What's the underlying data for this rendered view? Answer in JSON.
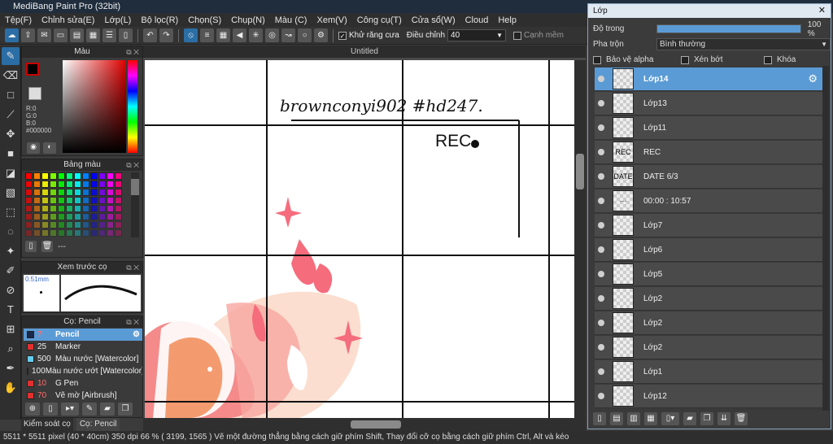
{
  "window": {
    "title": "MediBang Paint Pro (32bit)"
  },
  "menu": [
    "Tệp(F)",
    "Chỉnh sửa(E)",
    "Lớp(L)",
    "Bộ lọc(R)",
    "Chọn(S)",
    "Chụp(N)",
    "Màu (C)",
    "Xem(V)",
    "Công cụ(T)",
    "Cửa sổ(W)",
    "Cloud",
    "Help"
  ],
  "toolbar": {
    "antialias_label": "Khử răng cưa",
    "correction_label": "Điều chỉnh",
    "correction_value": "40",
    "edge_label": "Cạnh mềm"
  },
  "color_panel": {
    "title": "Màu",
    "r": "R:0",
    "g": "G:0",
    "b": "B:0",
    "hex": "#000000",
    "fg": "#000000",
    "bg": "#ffffff"
  },
  "palette": {
    "title": "Bảng màu",
    "footer": "---"
  },
  "preview": {
    "title": "Xem trước cọ",
    "size": "0.51mm"
  },
  "brush_panel": {
    "title": "Cọ: Pencil",
    "items": [
      {
        "size": "7",
        "name": "Pencil",
        "color": "#1a2a4a",
        "selected": true
      },
      {
        "size": "25",
        "name": "Marker",
        "color": "#e03030"
      },
      {
        "size": "500",
        "name": "Màu nước [Watercolor]",
        "color": "#66ccee"
      },
      {
        "size": "100",
        "name": "Màu nước ướt [Watercolor]",
        "color": "#66ccee"
      },
      {
        "size": "10",
        "name": "G Pen",
        "color": "#e03030"
      },
      {
        "size": "70",
        "name": "Vẽ mờ [Airbrush]",
        "color": "#e03030"
      }
    ]
  },
  "bottom_tabs": {
    "left": "Kiểm soát cọ",
    "right": "Cọ: Pencil"
  },
  "canvas": {
    "tab": "Untitled",
    "handwriting": "brownconyi902  #hd247.",
    "rec": "REC"
  },
  "layer_window": {
    "title": "Lớp",
    "opacity_label": "Độ trong",
    "opacity_value": "100 %",
    "opacity_fraction": 1.0,
    "blend_label": "Pha trộn",
    "blend_value": "Bình thường",
    "protect_alpha": "Bảo vệ alpha",
    "clip": "Xén bớt",
    "lock": "Khóa",
    "layers": [
      {
        "name": "Lớp14",
        "selected": true,
        "thumb": ""
      },
      {
        "name": "Lớp13",
        "thumb": ""
      },
      {
        "name": "Lớp11",
        "thumb": ""
      },
      {
        "name": "REC",
        "thumb": "REC"
      },
      {
        "name": "DATE 6/3",
        "thumb": "DATE"
      },
      {
        "name": "00:00 : 10:57",
        "thumb": "···"
      },
      {
        "name": "Lớp7",
        "thumb": ""
      },
      {
        "name": "Lớp6",
        "thumb": ""
      },
      {
        "name": "Lớp5",
        "thumb": ""
      },
      {
        "name": "Lớp2",
        "thumb": ""
      },
      {
        "name": "Lớp2",
        "thumb": ""
      },
      {
        "name": "Lớp2",
        "thumb": ""
      },
      {
        "name": "Lớp1",
        "thumb": ""
      },
      {
        "name": "Lớp12",
        "thumb": ""
      }
    ]
  },
  "status": "5511 * 5511 pixel  (40 * 40cm)  350 dpi  66 %  ( 3199, 1565 )  Vẽ một đường thẳng bằng cách giữ phím Shift, Thay đổi cỡ cọ bằng cách giữ phím Ctrl, Alt và kéo"
}
